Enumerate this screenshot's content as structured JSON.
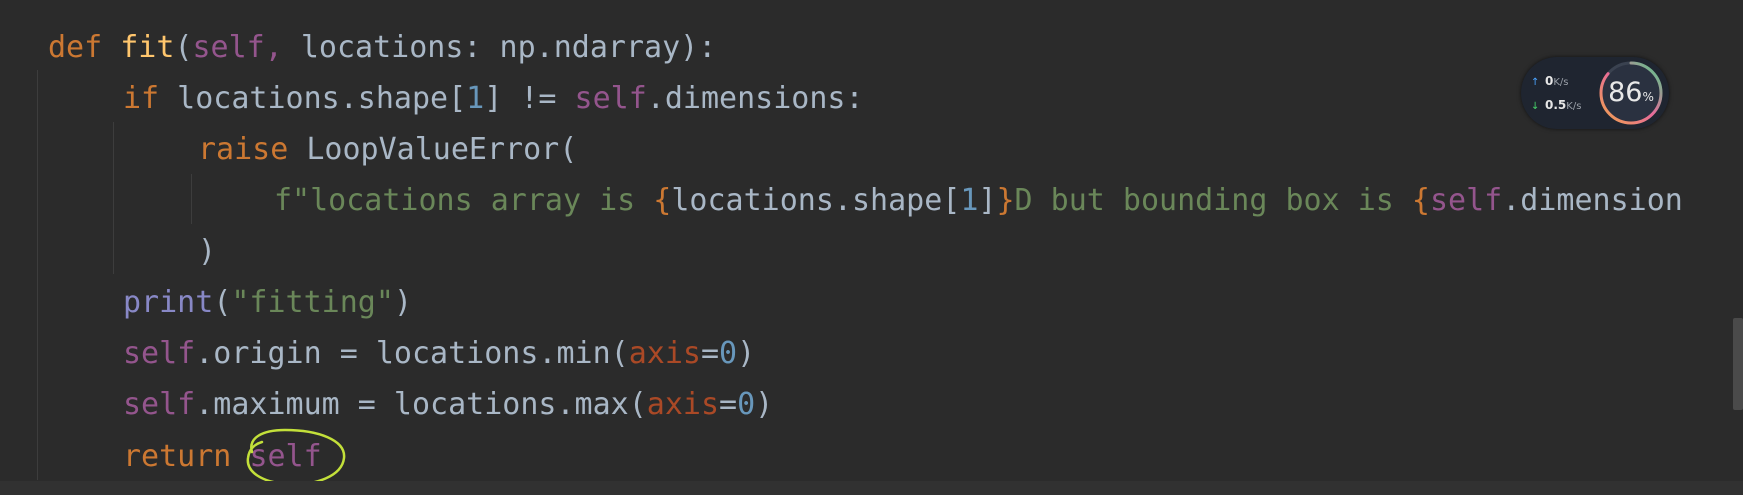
{
  "code": {
    "def_kw": "def",
    "fn_name": "fit",
    "params": {
      "open": "(",
      "self": "self,",
      "rest": " locations: np.ndarray):"
    },
    "if_kw": "if",
    "if_cond_a": " locations.shape[",
    "if_idx": "1",
    "if_cond_b": "] != ",
    "if_self": "self",
    "if_cond_c": ".dimensions:",
    "raise_kw": "raise",
    "raise_rest": " LoopValueError(",
    "fstr_head": "f\"locations array is ",
    "fstr_lbrace1": "{",
    "fstr_expr1": "locations.shape[",
    "fstr_idx1": "1",
    "fstr_expr1_end": "]",
    "fstr_rbrace1": "}",
    "fstr_mid": "D but bounding box is ",
    "fstr_lbrace2": "{",
    "fstr_self2": "self",
    "fstr_expr2": ".dimension",
    "close_paren": ")",
    "print_fn": "print",
    "print_open": "(",
    "print_str": "\"fitting\"",
    "print_close": ")",
    "origin_self": "self",
    "origin_a": ".origin = locations.min(",
    "origin_axis": "axis",
    "origin_eq": "=",
    "origin_num": "0",
    "origin_close": ")",
    "max_self": "self",
    "max_a": ".maximum = locations.max(",
    "max_axis": "axis",
    "max_eq": "=",
    "max_num": "0",
    "max_close": ")",
    "return_kw": "return",
    "return_self": "self"
  },
  "network_widget": {
    "upload_value": "0",
    "upload_unit": "K/s",
    "download_value": "0.5",
    "download_unit": "K/s",
    "usage_value": "86",
    "usage_unit": "%",
    "usage_fraction": 0.86
  }
}
